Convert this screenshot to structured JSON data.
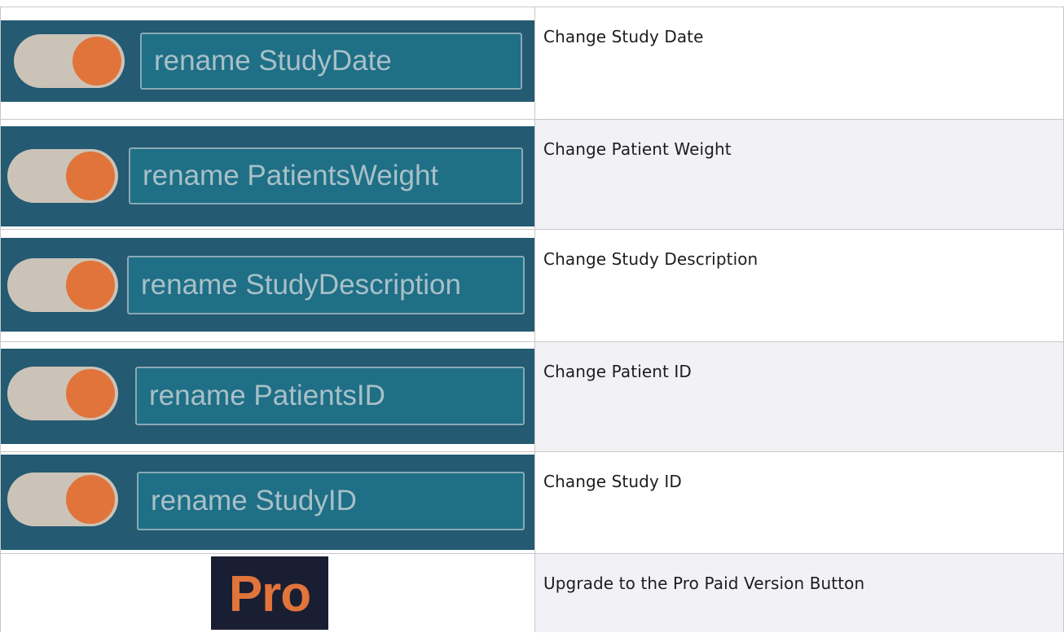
{
  "rows": [
    {
      "field_text": "rename StudyDate",
      "description": "Change Study Date"
    },
    {
      "field_text": "rename PatientsWeight",
      "description": "Change Patient Weight"
    },
    {
      "field_text": "rename StudyDescription",
      "description": "Change Study Description"
    },
    {
      "field_text": "rename PatientsID",
      "description": "Change Patient ID"
    },
    {
      "field_text": "rename StudyID",
      "description": "Change Study ID"
    }
  ],
  "pro_row": {
    "badge_text": "Pro",
    "description": "Upgrade to the Pro Paid Version Button"
  },
  "colors": {
    "panel_bg": "#245a72",
    "field_bg": "#1f6f86",
    "toggle_track": "#cbc3b8",
    "toggle_knob": "#e1743a",
    "pro_bg": "#1a1e33",
    "pro_text": "#e1743a",
    "alt_row_bg": "#f2f2f6"
  },
  "toggle_states": [
    true,
    true,
    true,
    true,
    true
  ]
}
